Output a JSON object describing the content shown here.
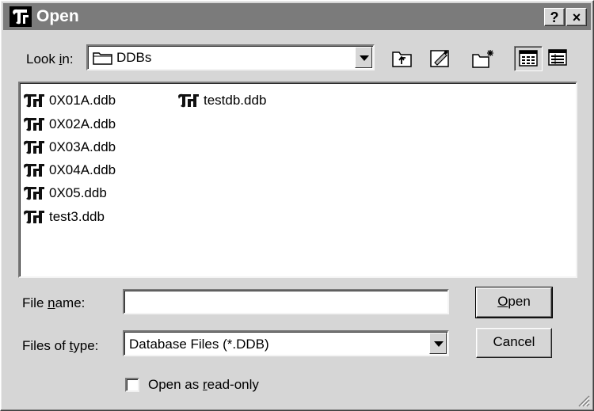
{
  "window": {
    "title": "Open",
    "help_label": "?",
    "close_label": "×"
  },
  "look_in": {
    "label_pre": "Look ",
    "label_key": "i",
    "label_post": "n:",
    "value": "DDBs",
    "icon": "folder-icon"
  },
  "toolbar": {
    "up_icon": "up-one-level-icon",
    "desktop_icon": "desktop-icon",
    "new_folder_icon": "new-folder-icon",
    "list_icon": "list-view-icon",
    "details_icon": "details-view-icon"
  },
  "files": [
    {
      "name": "0X01A.ddb"
    },
    {
      "name": "0X02A.ddb"
    },
    {
      "name": "0X03A.ddb"
    },
    {
      "name": "0X04A.ddb"
    },
    {
      "name": "0X05.ddb"
    },
    {
      "name": "test3.ddb"
    },
    {
      "name": "testdb.ddb"
    }
  ],
  "file_name": {
    "label_pre": "File ",
    "label_key": "n",
    "label_post": "ame:",
    "value": "",
    "placeholder": ""
  },
  "file_type": {
    "label_pre": "Files of ",
    "label_key": "t",
    "label_post": "ype:",
    "value": "Database Files (*.DDB)"
  },
  "read_only": {
    "label_pre": "Open as ",
    "label_key": "r",
    "label_post": "ead-only",
    "checked": false
  },
  "buttons": {
    "open_key": "O",
    "open_rest": "pen",
    "cancel": "Cancel"
  },
  "colors": {
    "titlebar": "#7b7b7b",
    "face": "#d6d6d6"
  }
}
